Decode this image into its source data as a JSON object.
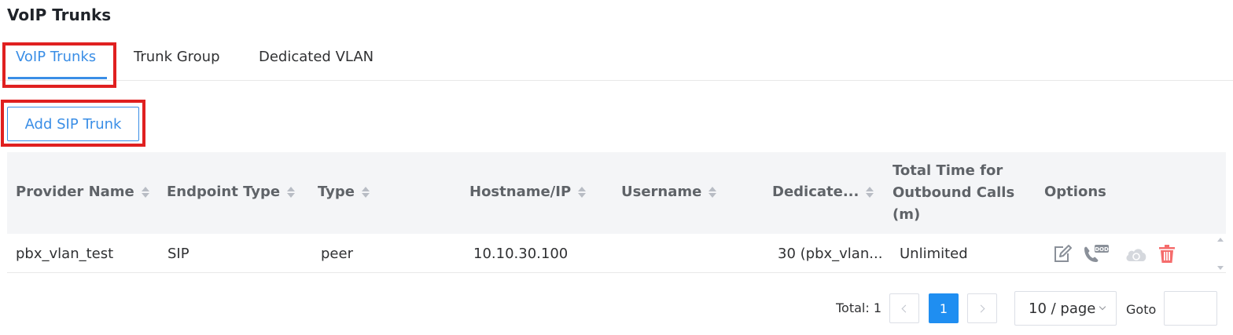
{
  "page": {
    "title": "VoIP Trunks"
  },
  "tabs": [
    {
      "label": "VoIP Trunks",
      "active": true
    },
    {
      "label": "Trunk Group",
      "active": false
    },
    {
      "label": "Dedicated VLAN",
      "active": false
    }
  ],
  "toolbar": {
    "add_label": "Add SIP Trunk"
  },
  "table": {
    "columns": [
      "Provider Name",
      "Endpoint Type",
      "Type",
      "Hostname/IP",
      "Username",
      "Dedicate...",
      [
        "Total Time for",
        "Outbound Calls",
        "(m)"
      ],
      "Options"
    ],
    "rows": [
      {
        "provider_name": "pbx_vlan_test",
        "endpoint_type": "SIP",
        "type": "peer",
        "hostname": "10.10.30.100",
        "username": "",
        "dedicated": "30 (pbx_vlan...",
        "total_time": "Unlimited",
        "options": [
          "edit-icon",
          "dod-icon",
          "cloud-sync-icon",
          "delete-icon"
        ],
        "dod_badge": "DOD"
      }
    ]
  },
  "pagination": {
    "total_label": "Total: 1",
    "current_page": "1",
    "page_size": "10 / page",
    "goto_label": "Goto",
    "goto_value": ""
  },
  "colors": {
    "accent": "#3a8ee6",
    "highlight": "#e02020",
    "delete": "#f56c6c",
    "icon": "#8a9099"
  }
}
